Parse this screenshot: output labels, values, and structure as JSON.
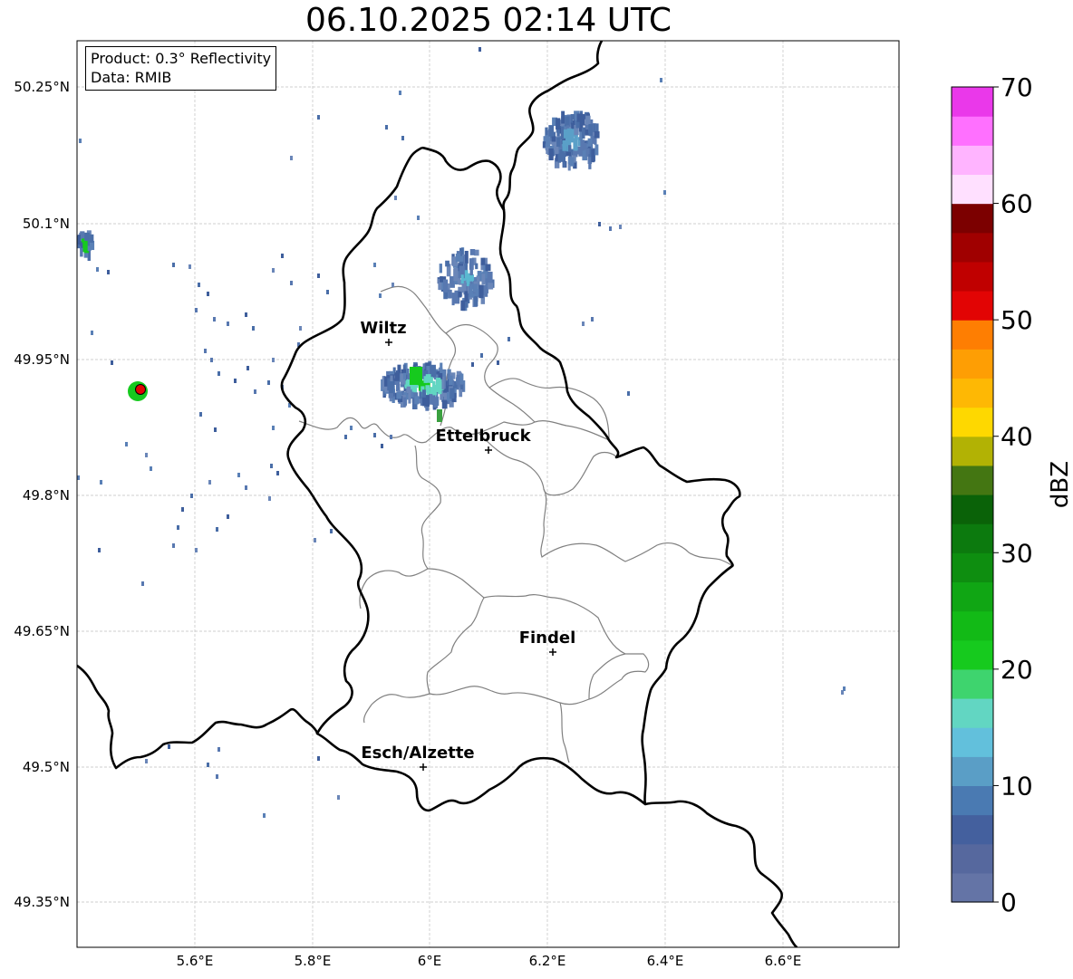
{
  "title": "06.10.2025 02:14 UTC",
  "info": {
    "product": "Product: 0.3° Reflectivity",
    "data": "Data: RMIB"
  },
  "lat_ticks": [
    "50.25°N",
    "50.1°N",
    "49.95°N",
    "49.8°N",
    "49.65°N",
    "49.5°N",
    "49.35°N"
  ],
  "lon_ticks": [
    "5.6°E",
    "5.8°E",
    "6°E",
    "6.2°E",
    "6.4°E",
    "6.6°E"
  ],
  "cities": [
    {
      "name": "Wiltz"
    },
    {
      "name": "Ettelbruck"
    },
    {
      "name": "Findel"
    },
    {
      "name": "Esch/Alzette"
    }
  ],
  "colorbar": {
    "label": "dBZ",
    "ticks": [
      "0",
      "10",
      "20",
      "30",
      "40",
      "50",
      "60",
      "70"
    ],
    "min": 0,
    "max": 70,
    "step": 2.5,
    "colors": [
      "#6474a6",
      "#56689e",
      "#44609e",
      "#4a7ab2",
      "#5a9ec6",
      "#62c0dc",
      "#62d6c2",
      "#3ed46e",
      "#16ca1e",
      "#12ba16",
      "#10a614",
      "#0e8e10",
      "#0c7a0e",
      "#0a6208",
      "#447612",
      "#b2b204",
      "#fed800",
      "#feb804",
      "#fe9e04",
      "#fe7e02",
      "#e20404",
      "#c00000",
      "#a00000",
      "#7c0000",
      "#ffe0ff",
      "#ffb4ff",
      "#ff70ff",
      "#ea38ea"
    ]
  },
  "colors": {
    "border": "#000000",
    "district_border": "#808080",
    "grid": "#c0c0c0",
    "echo_light": "#5878b0",
    "echo_medium": "#62d6c2",
    "echo_strong": "#16ca1e",
    "radar_site": "#e20404"
  }
}
